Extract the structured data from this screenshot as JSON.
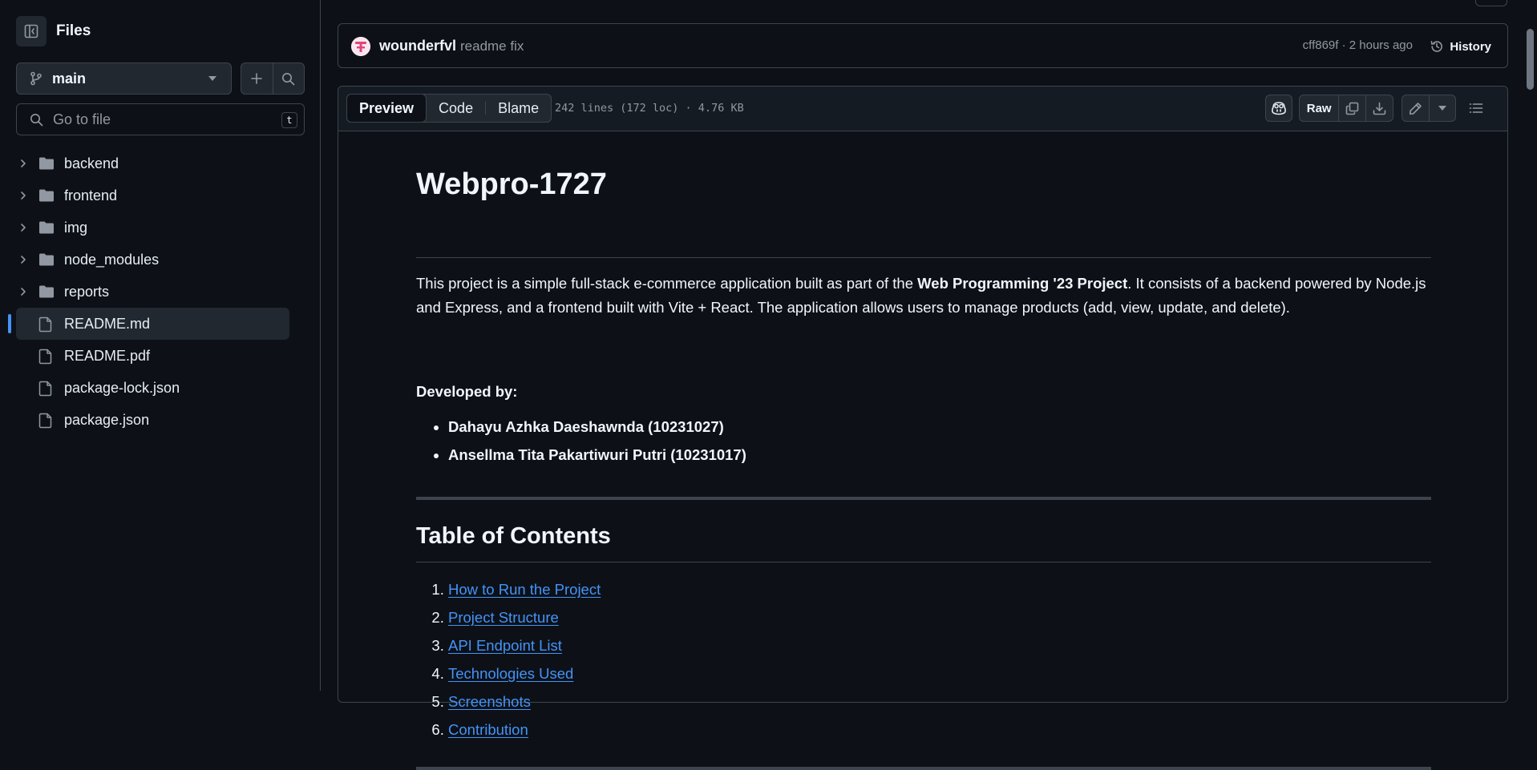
{
  "sidebar": {
    "title": "Files",
    "branch": "main",
    "search_placeholder": "Go to file",
    "search_shortcut": "t",
    "items": [
      {
        "label": "backend",
        "type": "folder"
      },
      {
        "label": "frontend",
        "type": "folder"
      },
      {
        "label": "img",
        "type": "folder"
      },
      {
        "label": "node_modules",
        "type": "folder"
      },
      {
        "label": "reports",
        "type": "folder"
      },
      {
        "label": "README.md",
        "type": "file",
        "selected": true
      },
      {
        "label": "README.pdf",
        "type": "file"
      },
      {
        "label": "package-lock.json",
        "type": "file"
      },
      {
        "label": "package.json",
        "type": "file"
      }
    ]
  },
  "commit": {
    "author": "wounderfvl",
    "message": "readme fix",
    "meta": "cff869f · 2 hours ago",
    "history_label": "History"
  },
  "file_header": {
    "tabs": [
      "Preview",
      "Code",
      "Blame"
    ],
    "active_tab": "Preview",
    "stats": "242 lines (172 loc) · 4.76 KB",
    "raw_label": "Raw"
  },
  "readme": {
    "title": "Webpro-1727",
    "intro_before": "This project is a simple full-stack e-commerce application built as part of the ",
    "intro_bold": "Web Programming '23 Project",
    "intro_after": ". It consists of a backend powered by Node.js and Express, and a frontend built with Vite + React. The application allows users to manage products (add, view, update, and delete).",
    "developed_by": "Developed by:",
    "developers": [
      "Dahayu Azhka Daeshawnda (10231027)",
      "Ansellma Tita Pakartiwuri Putri (10231017)"
    ],
    "toc_title": "Table of Contents",
    "toc": [
      "How to Run the Project",
      "Project Structure",
      "API Endpoint List",
      "Technologies Used",
      "Screenshots",
      "Contribution"
    ]
  },
  "colors": {
    "background": "#0d1117",
    "border": "#3d444d",
    "accent": "#4493f8",
    "muted_text": "#9198a1"
  }
}
